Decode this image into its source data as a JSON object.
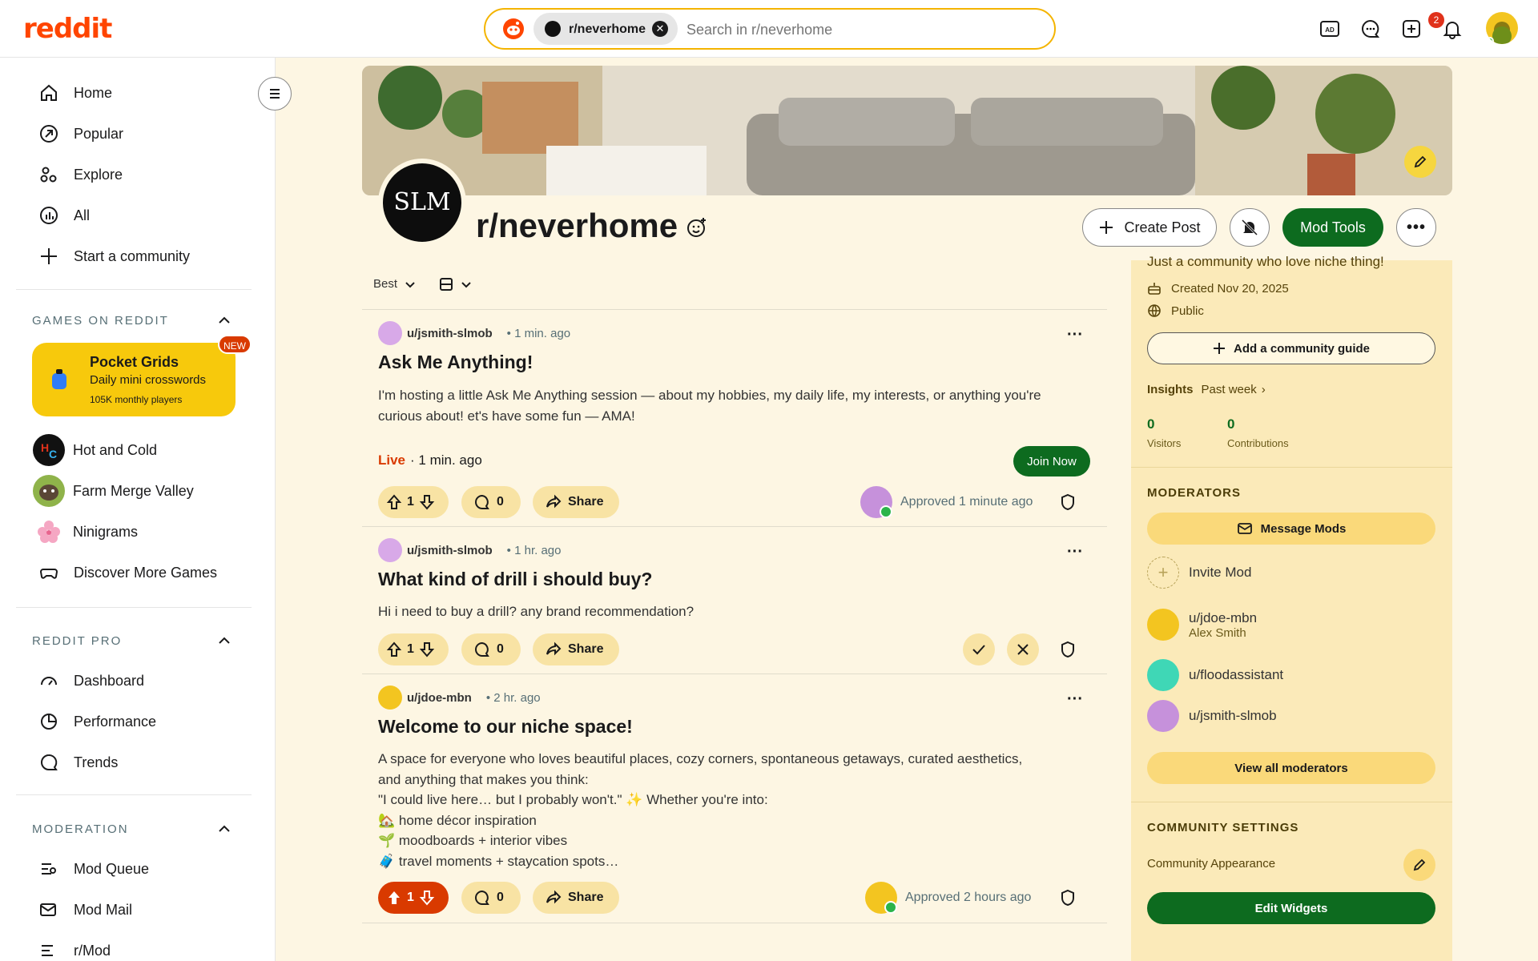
{
  "brand": {
    "logo": "reddit"
  },
  "search": {
    "chip_label": "r/neverhome",
    "placeholder": "Search in r/neverhome"
  },
  "header": {
    "notification_count": "2"
  },
  "colors": {
    "accent": "#ff4500",
    "mod_green": "#0d6b1f",
    "highlight_yellow": "#f7c90c",
    "sidebar_bg": "#fbeab9"
  },
  "nav": {
    "main": [
      {
        "label": "Home",
        "icon": "home-icon"
      },
      {
        "label": "Popular",
        "icon": "popular-icon"
      },
      {
        "label": "Explore",
        "icon": "explore-icon"
      },
      {
        "label": "All",
        "icon": "all-icon"
      },
      {
        "label": "Start a community",
        "icon": "plus-icon"
      }
    ],
    "games_header": "GAMES ON REDDIT",
    "featured_game": {
      "title": "Pocket Grids",
      "subtitle": "Daily mini crosswords",
      "players": "105K monthly players",
      "badge": "NEW"
    },
    "games": [
      {
        "label": "Hot and Cold"
      },
      {
        "label": "Farm Merge Valley"
      },
      {
        "label": "Ninigrams"
      },
      {
        "label": "Discover More Games"
      }
    ],
    "pro_header": "REDDIT PRO",
    "pro": [
      {
        "label": "Dashboard"
      },
      {
        "label": "Performance"
      },
      {
        "label": "Trends"
      }
    ],
    "mod_header": "MODERATION",
    "mod": [
      {
        "label": "Mod Queue"
      },
      {
        "label": "Mod Mail"
      },
      {
        "label": "r/Mod"
      }
    ]
  },
  "community": {
    "avatar_text": "SLM",
    "name": "r/neverhome",
    "create_post": "Create Post",
    "mod_tools": "Mod Tools"
  },
  "sort": {
    "label": "Best"
  },
  "posts": [
    {
      "author": "u/jsmith-slmob",
      "time": "• 1 min. ago",
      "title": "Ask Me Anything!",
      "body": "I'm hosting a little Ask Me Anything session — about my hobbies, my daily life, my interests, or anything you're curious about! et's have some fun — AMA!",
      "live_label": "Live",
      "live_time": "· 1 min. ago",
      "join_label": "Join Now",
      "votes": "1",
      "comments": "0",
      "share": "Share",
      "approved": "Approved 1 minute ago"
    },
    {
      "author": "u/jsmith-slmob",
      "time": "• 1 hr. ago",
      "title": "What kind of drill i should buy?",
      "body": "Hi i need to buy a drill? any brand recommendation?",
      "votes": "1",
      "comments": "0",
      "share": "Share"
    },
    {
      "author": "u/jdoe-mbn",
      "time": "• 2 hr. ago",
      "title": "Welcome to our niche space!",
      "body_lines": [
        "A space for everyone who loves beautiful places, cozy corners, spontaneous getaways, curated aesthetics,",
        "and anything that makes you think:",
        "\"I could live here… but I probably won't.\" ✨ Whether you're into:",
        "🏡 home décor inspiration",
        "🌱 moodboards + interior vibes",
        "🧳 travel moments + staycation spots…"
      ],
      "votes": "1",
      "comments": "0",
      "share": "Share",
      "approved": "Approved 2 hours ago"
    }
  ],
  "sidebar": {
    "description": "Just a community who love niche thing!",
    "created": "Created Nov 20, 2025",
    "visibility": "Public",
    "guide_btn": "Add a community guide",
    "insights_label": "Insights",
    "insights_range": "Past week",
    "visitors_value": "0",
    "visitors_label": "Visitors",
    "contrib_value": "0",
    "contrib_label": "Contributions",
    "moderators_header": "MODERATORS",
    "message_mods": "Message Mods",
    "invite_mod": "Invite Mod",
    "moderators": [
      {
        "name": "u/jdoe-mbn",
        "subtitle": "Alex Smith"
      },
      {
        "name": "u/floodassistant"
      },
      {
        "name": "u/jsmith-slmob"
      }
    ],
    "view_all": "View all moderators",
    "settings_header": "COMMUNITY SETTINGS",
    "appearance": "Community Appearance",
    "edit_widgets": "Edit Widgets"
  }
}
